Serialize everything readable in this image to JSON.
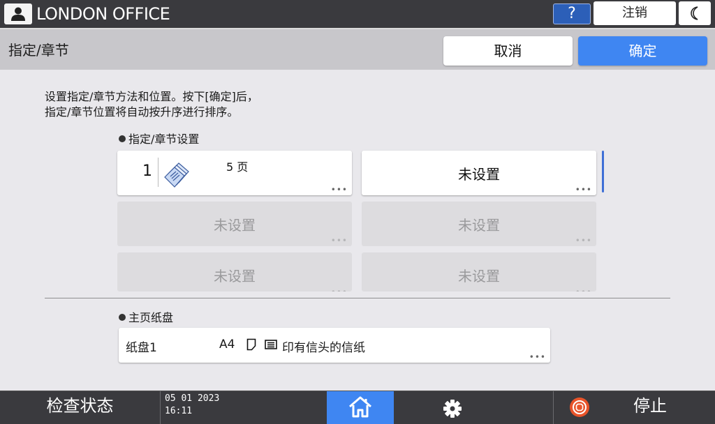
{
  "topbar": {
    "office_name": "LONDON OFFICE",
    "help_label": "?",
    "logout_label": "注销"
  },
  "header": {
    "title": "指定/章节",
    "cancel_label": "取消",
    "ok_label": "确定"
  },
  "description": {
    "line1": "设置指定/章节方法和位置。按下[确定]后，",
    "line2": "指定/章节位置将自动按升序进行排序。"
  },
  "designation": {
    "heading": "指定/章节设置",
    "slots": [
      {
        "number": "1",
        "pages": "5 页",
        "label": "",
        "state": "set"
      },
      {
        "label": "未设置",
        "state": "unset"
      },
      {
        "label": "未设置",
        "state": "disabled"
      },
      {
        "label": "未设置",
        "state": "disabled"
      },
      {
        "label": "未设置",
        "state": "disabled"
      },
      {
        "label": "未设置",
        "state": "disabled"
      }
    ],
    "more_glyph": "•••"
  },
  "main_tray": {
    "heading": "主页纸盘",
    "tray_name": "纸盘1",
    "paper_size": "A4",
    "paper_type": "印有信头的信纸",
    "more_glyph": "•••"
  },
  "bottombar": {
    "check_status_label": "检查状态",
    "date": "05 01 2023",
    "time": "16:11",
    "stop_label": "停止"
  },
  "colors": {
    "accent_blue": "#3f86f2",
    "bar_dark": "#3a3a3e",
    "stop_red": "#e8542a"
  }
}
